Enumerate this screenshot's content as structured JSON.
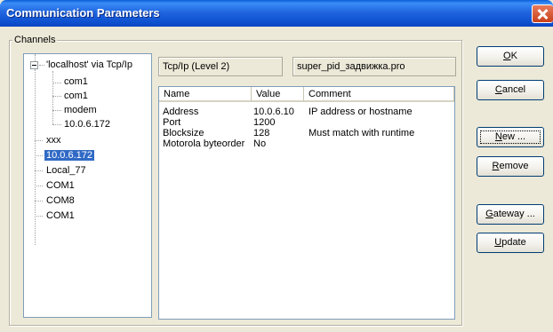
{
  "window": {
    "title": "Communication Parameters"
  },
  "group": {
    "label": "Channels"
  },
  "tree": {
    "root": "'localhost' via Tcp/Ip",
    "children": [
      "com1",
      "com1",
      "modem",
      "10.0.6.172"
    ],
    "items": [
      "xxx",
      "10.0.6.172",
      "Local_77",
      "COM1",
      "COM8",
      "COM1"
    ],
    "selected_index": 1
  },
  "fields": {
    "driver": "Tcp/Ip (Level 2)",
    "project": "super_pid_задвижка.pro"
  },
  "table": {
    "headers": [
      "Name",
      "Value",
      "Comment"
    ],
    "rows": [
      [
        "Address",
        "10.0.6.10",
        "IP address or hostname"
      ],
      [
        "Port",
        "1200",
        ""
      ],
      [
        "Blocksize",
        "128",
        "Must match with runtime"
      ],
      [
        "Motorola byteorder",
        "No",
        ""
      ]
    ]
  },
  "buttons": {
    "ok": {
      "u": "O",
      "rest": "K"
    },
    "cancel": {
      "u": "C",
      "rest": "ancel"
    },
    "new": {
      "u": "N",
      "rest": "ew ..."
    },
    "remove": {
      "u": "R",
      "rest": "emove"
    },
    "gateway": {
      "u": "G",
      "rest": "ateway ..."
    },
    "update": {
      "u": "U",
      "rest": "pdate"
    }
  },
  "colors": {
    "title_bar": "#0A5FD8",
    "selection": "#316AC5",
    "dialog_bg": "#ECE9D8",
    "close_button": "#C8411A"
  }
}
